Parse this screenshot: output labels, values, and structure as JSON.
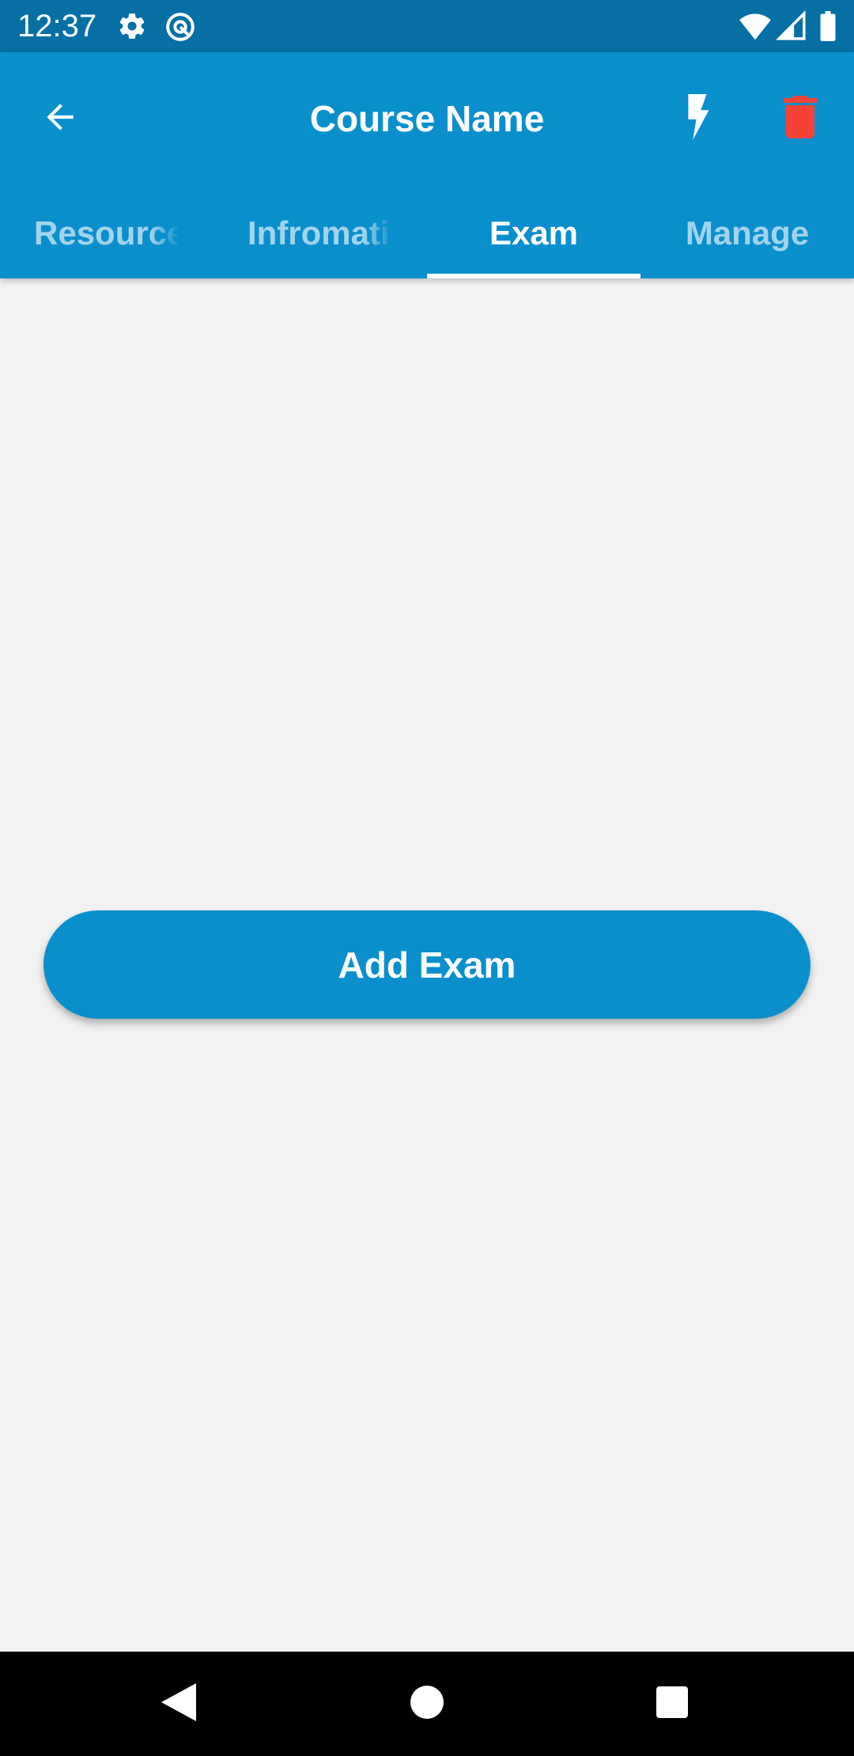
{
  "status_bar": {
    "time": "12:37",
    "icons": [
      "gear-icon",
      "at-sign-icon",
      "wifi-icon",
      "cell-signal-icon",
      "battery-icon"
    ]
  },
  "app_bar": {
    "title": "Course Name",
    "back_icon": "arrow-left-icon",
    "actions": [
      {
        "name": "flash-icon",
        "color": "#FFFFFF"
      },
      {
        "name": "trash-icon",
        "color": "#F44336"
      }
    ],
    "background": "#0A8FCD"
  },
  "tabs": [
    {
      "label": "Resources",
      "active": false
    },
    {
      "label": "Infromation",
      "active": false
    },
    {
      "label": "Exam",
      "active": true
    },
    {
      "label": "Manage",
      "active": false
    }
  ],
  "main": {
    "add_exam_label": "Add Exam"
  },
  "nav_bar": {
    "buttons": [
      "back-triangle-icon",
      "home-circle-icon",
      "recents-square-icon"
    ]
  },
  "colors": {
    "primary": "#0A8FCD",
    "status_bar": "#066FA3",
    "background": "#F2F2F2",
    "delete": "#F44336"
  }
}
